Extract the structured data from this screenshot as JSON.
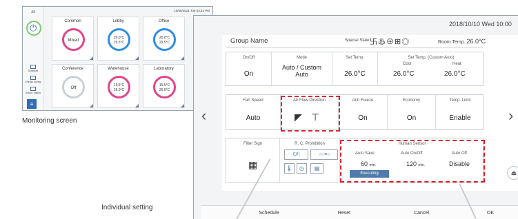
{
  "monitoring": {
    "caption": "Monitoring screen",
    "timestamp": "10/05/2021 Tue 03:44 PM",
    "all_label": "All",
    "sidebar": [
      {
        "label": "Schedule"
      },
      {
        "label": "Energy Saving"
      },
      {
        "label": "Setup / Status"
      }
    ],
    "cards": [
      {
        "label": "Common",
        "ring_text": "Mixed",
        "ring_color": "#e0468a"
      },
      {
        "label": "Lobby",
        "ring_text": "20.0°C 29.5°C",
        "ring_color": "#2f8de0"
      },
      {
        "label": "Office",
        "ring_text": "20.0°C 29.5°C",
        "ring_color": "#2f8de0"
      },
      {
        "label": "Conference",
        "ring_text": "Off",
        "ring_color": "#c7d0d6"
      },
      {
        "label": "Warehouse",
        "ring_text": "15.5°C 26.0°C",
        "ring_color": "#e0468a"
      },
      {
        "label": "Laboratory",
        "ring_text": "15.5°C 26.0°C",
        "ring_color": "#e0468a"
      }
    ]
  },
  "individual": {
    "caption": "Individual setting",
    "date": "2018/10/10 Wed 10:00",
    "group_name": "Group Name",
    "special_state_label": "Special State",
    "special_state_icons": "卐♨⊕⊞◎",
    "room_temp_label": "Room Temp.",
    "room_temp_value": "26.0°C",
    "row1": {
      "on_off": {
        "title": "On/Off",
        "value": "On"
      },
      "mode": {
        "title": "Mode",
        "value": "Auto / Custom Auto"
      },
      "set_temp": {
        "title": "Set Temp.",
        "value": "26.0°C"
      },
      "set_temp_custom": {
        "title": "Set Temp. (Custom Auto)",
        "cool_label": "Cool",
        "heat_label": "Heat",
        "cool_value": "26.0°C",
        "heat_value": "26.0°C"
      }
    },
    "row2": {
      "fan_speed": {
        "title": "Fan Speed",
        "value": "Auto"
      },
      "air_flow": {
        "title": "Air Flow Direction"
      },
      "anti_freeze": {
        "title": "Anti Freeze",
        "value": "On"
      },
      "economy": {
        "title": "Economy",
        "value": "On"
      },
      "temp_limit": {
        "title": "Temp. Limit",
        "value": "Enable"
      }
    },
    "row3": {
      "filter_sign": {
        "title": "Filter Sign"
      },
      "rc_prohibition": {
        "title": "R. C. Prohibition",
        "btn1": "⏻/|",
        "btn2": "○○≡○"
      },
      "human_sensor": {
        "title": "Human Sensor"
      },
      "auto_save": {
        "title": "Auto Save",
        "value": "60",
        "unit": "min.",
        "status": "Executing"
      },
      "auto_onoff": {
        "title": "Auto On/Off",
        "value": "120",
        "unit": "min."
      },
      "auto_off": {
        "title": "Auto Off",
        "value": "Disable"
      }
    },
    "bottom": {
      "schedule": "Schedule",
      "reset": "Reset",
      "cancel": "Cancel",
      "ok": "OK"
    }
  }
}
